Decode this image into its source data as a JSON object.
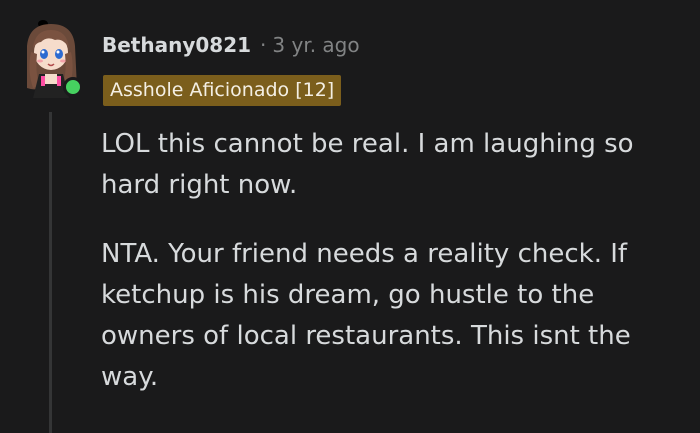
{
  "comment": {
    "username": "Bethany0821",
    "separator": "·",
    "timestamp": "3 yr. ago",
    "flair": "Asshole Aficionado [12]",
    "avatar_icon": "anime-girl-avatar-icon",
    "online_status_color": "#46d160",
    "flair_color": "#7b5e1c",
    "paragraphs": [
      "LOL this cannot be real. I am laughing so hard right now.",
      "NTA. Your friend needs a reality check. If ketchup is his dream, go hustle to the owners of local restaurants. This isnt the way."
    ]
  }
}
